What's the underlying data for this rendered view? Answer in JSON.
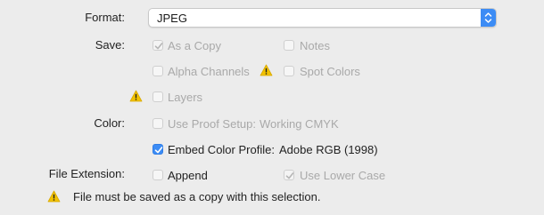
{
  "format": {
    "label": "Format:",
    "value": "JPEG"
  },
  "save": {
    "label": "Save:",
    "as_a_copy": {
      "label": "As a Copy",
      "checked": true,
      "enabled": false
    },
    "notes": {
      "label": "Notes",
      "checked": false,
      "enabled": false
    },
    "alpha_channels": {
      "label": "Alpha Channels",
      "checked": false,
      "enabled": false
    },
    "spot_colors": {
      "label": "Spot Colors",
      "checked": false,
      "enabled": false
    },
    "layers": {
      "label": "Layers",
      "checked": false,
      "enabled": false
    }
  },
  "color": {
    "label": "Color:",
    "use_proof_setup": {
      "label": "Use Proof Setup:",
      "value": "Working CMYK",
      "checked": false,
      "enabled": false
    },
    "embed_color_profile": {
      "label": "Embed Color Profile:",
      "value": "Adobe RGB (1998)",
      "checked": true,
      "enabled": true
    }
  },
  "file_extension": {
    "label": "File Extension:",
    "append": {
      "label": "Append",
      "checked": false,
      "enabled": true
    },
    "use_lower_case": {
      "label": "Use Lower Case",
      "checked": true,
      "enabled": false
    }
  },
  "warning_message": "File must be saved as a copy with this selection.",
  "colors": {
    "accent": "#3c8cf5",
    "warning": "#f2c200",
    "disabled_text": "#a9a9a9"
  }
}
